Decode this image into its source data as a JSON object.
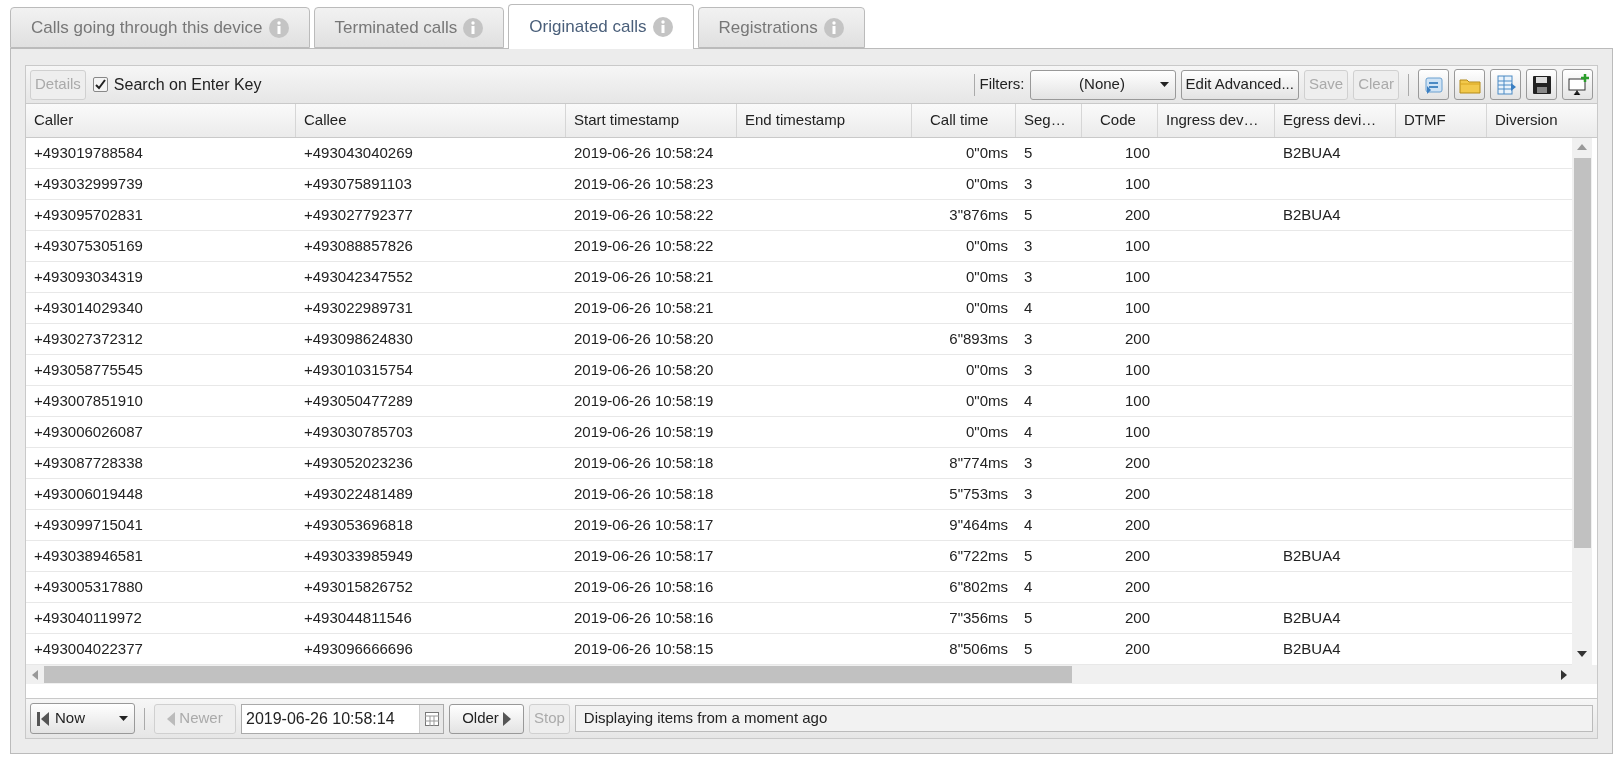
{
  "tabs": [
    {
      "label": "Calls going through this device",
      "selected": false
    },
    {
      "label": "Terminated calls",
      "selected": false
    },
    {
      "label": "Originated calls",
      "selected": true
    },
    {
      "label": "Registrations",
      "selected": false
    }
  ],
  "toolbar": {
    "details": {
      "label": "Details",
      "disabled": true
    },
    "search_on_enter": {
      "label": "Search on Enter Key",
      "checked": true
    },
    "filters_label": "Filters:",
    "filter_value": "(None)",
    "edit_advanced": {
      "label": "Edit Advanced...",
      "disabled": false
    },
    "save": {
      "label": "Save",
      "disabled": true
    },
    "clear": {
      "label": "Clear",
      "disabled": true
    }
  },
  "table": {
    "columns": [
      {
        "label": "Caller",
        "kind": "text"
      },
      {
        "label": "Callee",
        "kind": "text"
      },
      {
        "label": "Start timestamp",
        "kind": "text"
      },
      {
        "label": "End timestamp",
        "kind": "text"
      },
      {
        "label": "Call time",
        "kind": "number"
      },
      {
        "label": "Seg…",
        "kind": "text"
      },
      {
        "label": "Code",
        "kind": "number"
      },
      {
        "label": "Ingress dev…",
        "kind": "text"
      },
      {
        "label": "Egress devi…",
        "kind": "text"
      },
      {
        "label": "DTMF",
        "kind": "text"
      },
      {
        "label": "Diversion",
        "kind": "text"
      }
    ],
    "rows": [
      [
        "+493019788584",
        "+493043040269",
        "2019-06-26 10:58:24",
        "",
        "0\"0ms",
        "5",
        "100",
        "",
        "B2BUA4",
        "",
        ""
      ],
      [
        "+493032999739",
        "+493075891103",
        "2019-06-26 10:58:23",
        "",
        "0\"0ms",
        "3",
        "100",
        "",
        "",
        "",
        ""
      ],
      [
        "+493095702831",
        "+493027792377",
        "2019-06-26 10:58:22",
        "",
        "3\"876ms",
        "5",
        "200",
        "",
        "B2BUA4",
        "",
        ""
      ],
      [
        "+493075305169",
        "+493088857826",
        "2019-06-26 10:58:22",
        "",
        "0\"0ms",
        "3",
        "100",
        "",
        "",
        "",
        ""
      ],
      [
        "+493093034319",
        "+493042347552",
        "2019-06-26 10:58:21",
        "",
        "0\"0ms",
        "3",
        "100",
        "",
        "",
        "",
        ""
      ],
      [
        "+493014029340",
        "+493022989731",
        "2019-06-26 10:58:21",
        "",
        "0\"0ms",
        "4",
        "100",
        "",
        "",
        "",
        ""
      ],
      [
        "+493027372312",
        "+493098624830",
        "2019-06-26 10:58:20",
        "",
        "6\"893ms",
        "3",
        "200",
        "",
        "",
        "",
        ""
      ],
      [
        "+493058775545",
        "+493010315754",
        "2019-06-26 10:58:20",
        "",
        "0\"0ms",
        "3",
        "100",
        "",
        "",
        "",
        ""
      ],
      [
        "+493007851910",
        "+493050477289",
        "2019-06-26 10:58:19",
        "",
        "0\"0ms",
        "4",
        "100",
        "",
        "",
        "",
        ""
      ],
      [
        "+493006026087",
        "+493030785703",
        "2019-06-26 10:58:19",
        "",
        "0\"0ms",
        "4",
        "100",
        "",
        "",
        "",
        ""
      ],
      [
        "+493087728338",
        "+493052023236",
        "2019-06-26 10:58:18",
        "",
        "8\"774ms",
        "3",
        "200",
        "",
        "",
        "",
        ""
      ],
      [
        "+493006019448",
        "+493022481489",
        "2019-06-26 10:58:18",
        "",
        "5\"753ms",
        "3",
        "200",
        "",
        "",
        "",
        ""
      ],
      [
        "+493099715041",
        "+493053696818",
        "2019-06-26 10:58:17",
        "",
        "9\"464ms",
        "4",
        "200",
        "",
        "",
        "",
        ""
      ],
      [
        "+493038946581",
        "+493033985949",
        "2019-06-26 10:58:17",
        "",
        "6\"722ms",
        "5",
        "200",
        "",
        "B2BUA4",
        "",
        ""
      ],
      [
        "+493005317880",
        "+493015826752",
        "2019-06-26 10:58:16",
        "",
        "6\"802ms",
        "4",
        "200",
        "",
        "",
        "",
        ""
      ],
      [
        "+493040119972",
        "+493044811546",
        "2019-06-26 10:58:16",
        "",
        "7\"356ms",
        "5",
        "200",
        "",
        "B2BUA4",
        "",
        ""
      ],
      [
        "+493004022377",
        "+493096666696",
        "2019-06-26 10:58:15",
        "",
        "8\"506ms",
        "5",
        "200",
        "",
        "B2BUA4",
        "",
        ""
      ]
    ]
  },
  "paging": {
    "now": "Now",
    "newer": {
      "label": "Newer",
      "disabled": true
    },
    "date": "2019-06-26 10:58:14",
    "older": {
      "label": "Older",
      "disabled": false
    },
    "stop": {
      "label": "Stop",
      "disabled": true
    },
    "status": "Displaying items from a moment ago"
  }
}
